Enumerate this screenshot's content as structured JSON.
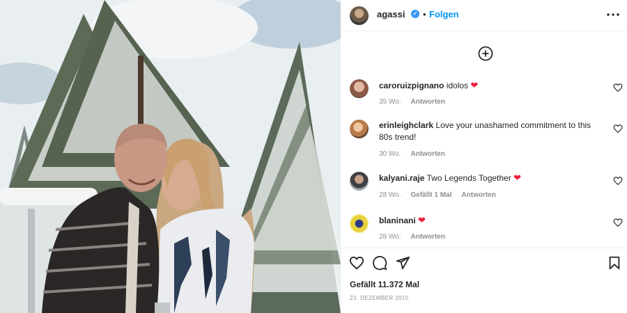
{
  "post": {
    "username": "agassi",
    "separator": "•",
    "follow_label": "Folgen",
    "likes_text": "Gefällt 11.372 Mal",
    "date_text": "23. DEZEMBER 2015"
  },
  "icons": {
    "verified": "verified-badge-icon",
    "more": "more-options-icon",
    "add_comment": "plus-circle-icon",
    "like": "heart-outline-icon",
    "comment": "comment-bubble-icon",
    "share": "paper-plane-icon",
    "save": "bookmark-icon"
  },
  "colors": {
    "accent": "#0095f6",
    "verified": "#3897f0",
    "heart": "#ed1c3a",
    "muted": "#8e8e8e"
  },
  "comments": [
    {
      "user": "caroruizpignano",
      "text": "idolos",
      "heart": "❤",
      "time": "35 Wo.",
      "reply": "Antworten"
    },
    {
      "user": "erinleighclark",
      "text": "Love your unashamed commitment to this 80s trend!",
      "heart": "",
      "time": "30 Wo.",
      "reply": "Antworten"
    },
    {
      "user": "kalyani.raje",
      "text": "Two Legends Together",
      "heart": "❤",
      "time": "28 Wo.",
      "likes": "Gefällt 1 Mal",
      "reply": "Antworten"
    },
    {
      "user": "blaninani",
      "text": "",
      "heart": "❤",
      "time": "28 Wo.",
      "reply": "Antworten"
    }
  ]
}
